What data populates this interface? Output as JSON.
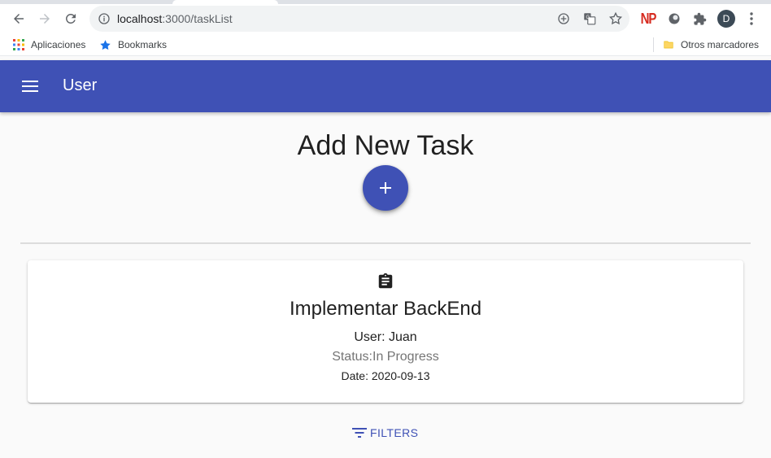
{
  "browser": {
    "url_host": "localhost",
    "url_path": ":3000/taskList",
    "bookmarks": [
      {
        "label": "Aplicaciones",
        "icon": "apps-grid-icon"
      },
      {
        "label": "Bookmarks",
        "icon": "star-icon"
      }
    ],
    "other_bookmarks": {
      "label": "Otros marcadores",
      "icon": "folder-icon"
    },
    "extensions": [
      "NP",
      "circle-extension-icon",
      "puzzle-icon"
    ],
    "profile_initial": "D"
  },
  "appbar": {
    "title": "User",
    "color": "#3f51b5"
  },
  "main": {
    "title": "Add New Task",
    "add_button_icon": "plus-icon"
  },
  "tasks": [
    {
      "icon": "clipboard-icon",
      "title": "Implementar BackEnd",
      "user": "User: Juan",
      "status": "Status:In Progress",
      "date": "Date: 2020-09-13"
    }
  ],
  "filters": {
    "label": "FILTERS",
    "icon": "filter-list-icon"
  }
}
